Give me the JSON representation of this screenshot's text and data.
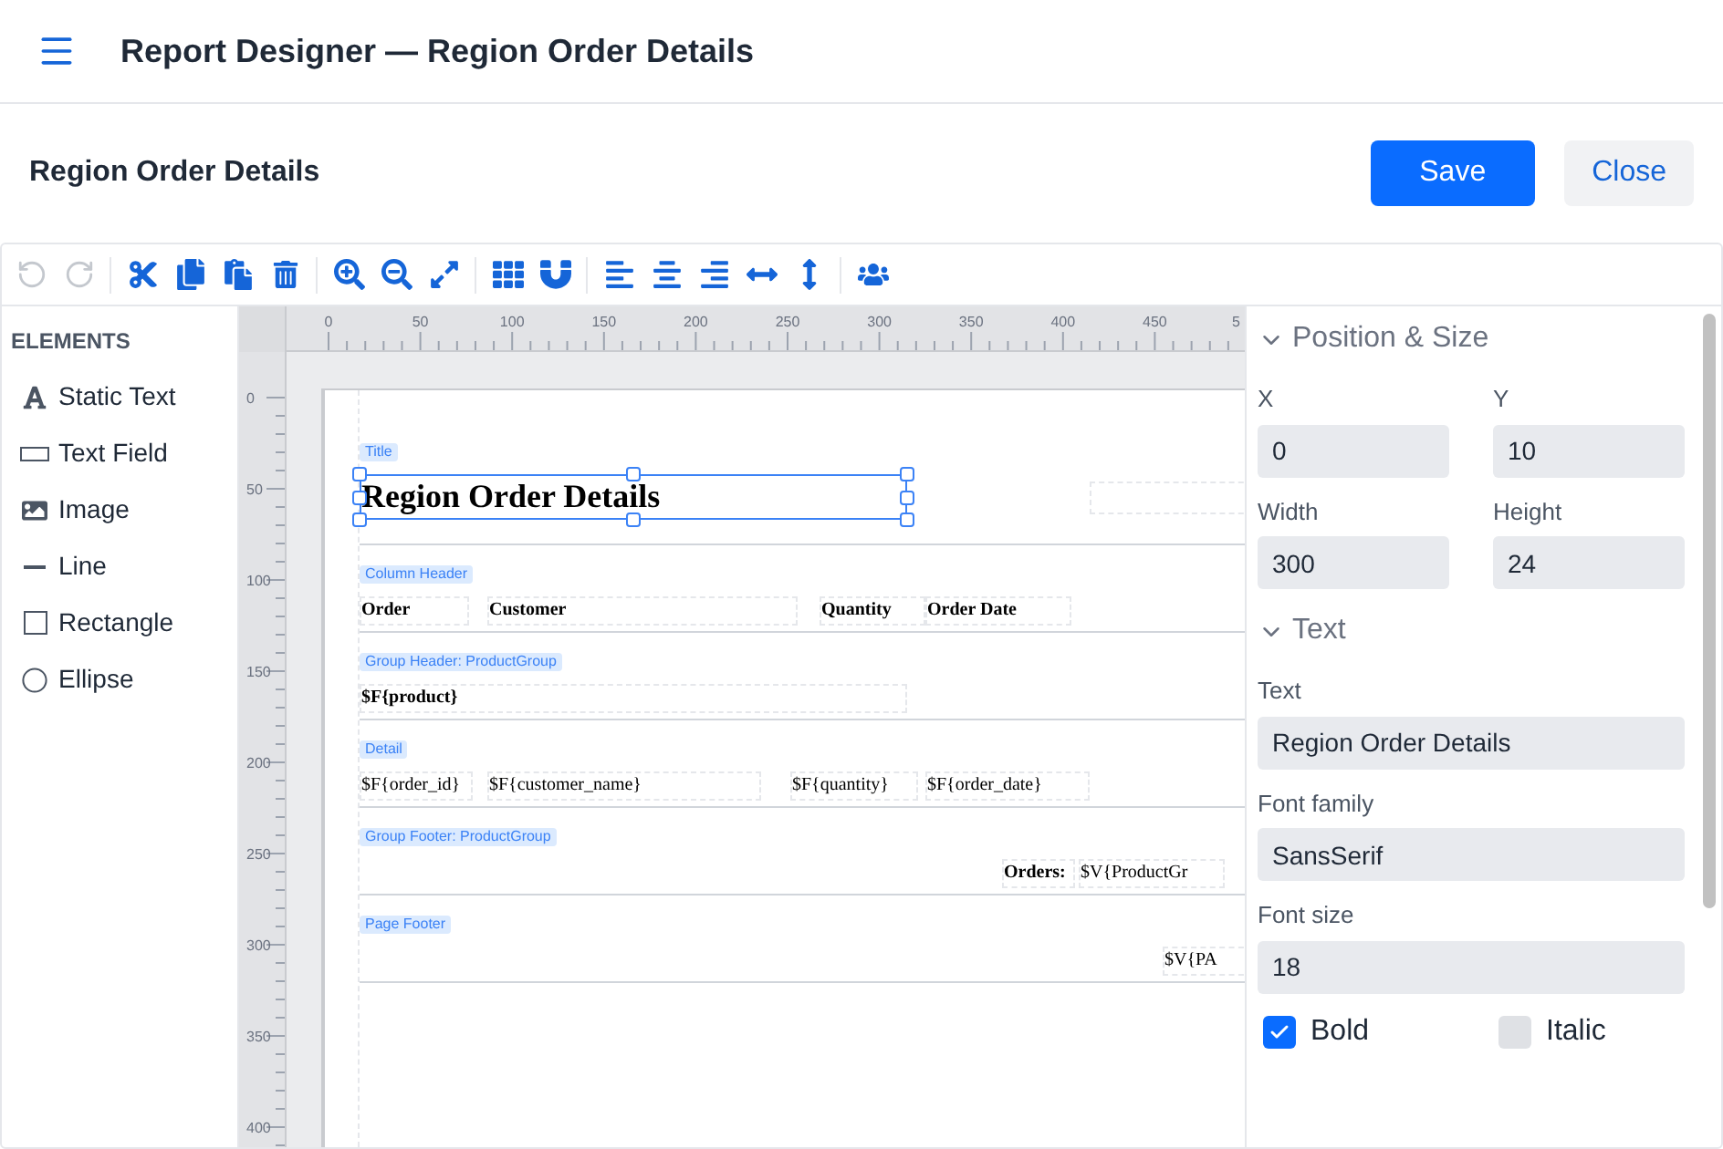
{
  "app_bar": {
    "title": "Report Designer — Region Order Details"
  },
  "report_header": {
    "title": "Region Order Details",
    "buttons": [
      {
        "label": "Save",
        "kind": "primary"
      },
      {
        "label": "Close",
        "kind": "secondary"
      }
    ]
  },
  "toolbar": {
    "undo": {
      "disabled": true
    },
    "redo": {
      "disabled": true
    }
  },
  "elements_panel": {
    "heading": "ELEMENTS",
    "items": [
      {
        "label": "Static Text"
      },
      {
        "label": "Text Field"
      },
      {
        "label": "Image"
      },
      {
        "label": "Line"
      },
      {
        "label": "Rectangle"
      },
      {
        "label": "Ellipse"
      }
    ]
  },
  "rulers": {
    "horizontal": [
      "0",
      "50",
      "100",
      "150",
      "200",
      "250",
      "300",
      "350",
      "400",
      "450",
      "5"
    ],
    "vertical": [
      "0",
      "50",
      "100",
      "150",
      "200",
      "250",
      "300",
      "350",
      "400"
    ]
  },
  "report": {
    "bands": [
      {
        "label": "Title",
        "fields": [
          {
            "text": "Region Order Details",
            "bold": true,
            "selected": true
          }
        ]
      },
      {
        "label": "Column Header",
        "fields": [
          {
            "text": "Order",
            "bold": true,
            "selected": false
          },
          {
            "text": "Customer",
            "bold": true,
            "selected": false
          },
          {
            "text": "Quantity",
            "bold": true,
            "selected": false
          },
          {
            "text": "Order Date",
            "bold": true,
            "selected": false
          }
        ]
      },
      {
        "label": "Group Header: ProductGroup",
        "fields": [
          {
            "text": "$F{product}",
            "bold": true,
            "selected": false
          }
        ]
      },
      {
        "label": "Detail",
        "fields": [
          {
            "text": "$F{order_id}",
            "bold": false,
            "selected": false
          },
          {
            "text": "$F{customer_name}",
            "bold": false,
            "selected": false
          },
          {
            "text": "$F{quantity}",
            "bold": false,
            "selected": false
          },
          {
            "text": "$F{order_date}",
            "bold": false,
            "selected": false
          }
        ]
      },
      {
        "label": "Group Footer: ProductGroup",
        "fields": [
          {
            "text": "Orders:",
            "bold": true,
            "selected": false
          },
          {
            "text": "$V{ProductGr",
            "bold": false,
            "selected": false
          }
        ]
      },
      {
        "label": "Page Footer",
        "fields": [
          {
            "text": "$V{PA",
            "bold": false,
            "selected": false
          }
        ]
      }
    ]
  },
  "properties": {
    "sections": [
      {
        "title": "Position & Size",
        "expanded": true,
        "fields": [
          {
            "label": "X",
            "value": "0"
          },
          {
            "label": "Y",
            "value": "10"
          },
          {
            "label": "Width",
            "value": "300"
          },
          {
            "label": "Height",
            "value": "24"
          }
        ]
      },
      {
        "title": "Text",
        "expanded": true,
        "fields": [
          {
            "label": "Text",
            "value": "Region Order Details"
          },
          {
            "label": "Font family",
            "value": "SansSerif"
          },
          {
            "label": "Font size",
            "value": "18"
          }
        ],
        "checkboxes": [
          {
            "label": "Bold",
            "checked": true
          },
          {
            "label": "Italic",
            "checked": false
          }
        ]
      }
    ]
  }
}
